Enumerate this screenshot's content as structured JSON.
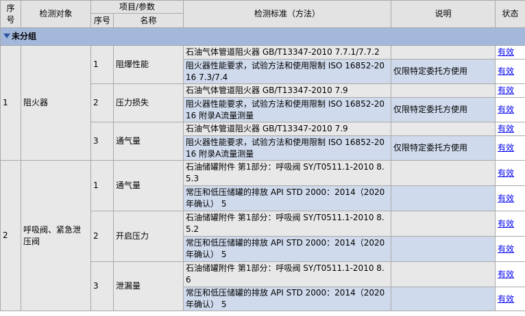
{
  "headers": {
    "seq": "序号",
    "object": "检测对象",
    "item_param": "项目/参数",
    "item_seq": "序号",
    "item_name": "名称",
    "standard": "检测标准（方法）",
    "note": "说明",
    "status": "状态"
  },
  "group_label": "未分组",
  "objects": [
    {
      "seq": "1",
      "name": "阻火器",
      "items": [
        {
          "seq": "1",
          "name": "阻爆性能",
          "standards": [
            {
              "text": "石油气体管道阻火器 GB/T13347-2010 7.7.1/7.7.2",
              "note": "",
              "status": "有效"
            },
            {
              "text": "阻火器性能要求，试验方法和使用限制 ISO 16852-2016 7.3/7.4",
              "note": "仅限特定委托方使用",
              "status": "有效"
            }
          ]
        },
        {
          "seq": "2",
          "name": "压力损失",
          "standards": [
            {
              "text": "石油气体管道阻火器 GB/T13347-2010 7.9",
              "note": "",
              "status": "有效"
            },
            {
              "text": "阻火器性能要求，试验方法和使用限制 ISO 16852-2016 附录A流量测量",
              "note": "仅限特定委托方使用",
              "status": "有效"
            }
          ]
        },
        {
          "seq": "3",
          "name": "通气量",
          "standards": [
            {
              "text": "石油气体管道阻火器 GB/T13347-2010 7.9",
              "note": "",
              "status": "有效"
            },
            {
              "text": "阻火器性能要求，试验方法和使用限制 ISO 16852-2016 附录A流量测量",
              "note": "仅限特定委托方使用",
              "status": "有效"
            }
          ]
        }
      ]
    },
    {
      "seq": "2",
      "name": "呼吸阀、紧急泄压阀",
      "items": [
        {
          "seq": "1",
          "name": "通气量",
          "standards": [
            {
              "text": "石油储罐附件 第1部分：呼吸阀 SY/T0511.1-2010 8.5.3",
              "note": "",
              "status": "有效"
            },
            {
              "text": "常压和低压储罐的排放 API STD 2000：2014（2020年确认） 5",
              "note": "",
              "status": "有效"
            }
          ]
        },
        {
          "seq": "2",
          "name": "开启压力",
          "standards": [
            {
              "text": "石油储罐附件 第1部分：呼吸阀 SY/T0511.1-2010 8.5.2",
              "note": "",
              "status": "有效"
            },
            {
              "text": "常压和低压储罐的排放 API STD 2000：2014（2020年确认） 5",
              "note": "",
              "status": "有效"
            }
          ]
        },
        {
          "seq": "3",
          "name": "泄漏量",
          "standards": [
            {
              "text": "石油储罐附件 第1部分：呼吸阀 SY/T0511.1-2010 8.6",
              "note": "",
              "status": "有效"
            },
            {
              "text": "常压和低压储罐的排放 API STD 2000：2014（2020年确认） 5",
              "note": "",
              "status": "有效"
            }
          ]
        }
      ]
    }
  ]
}
